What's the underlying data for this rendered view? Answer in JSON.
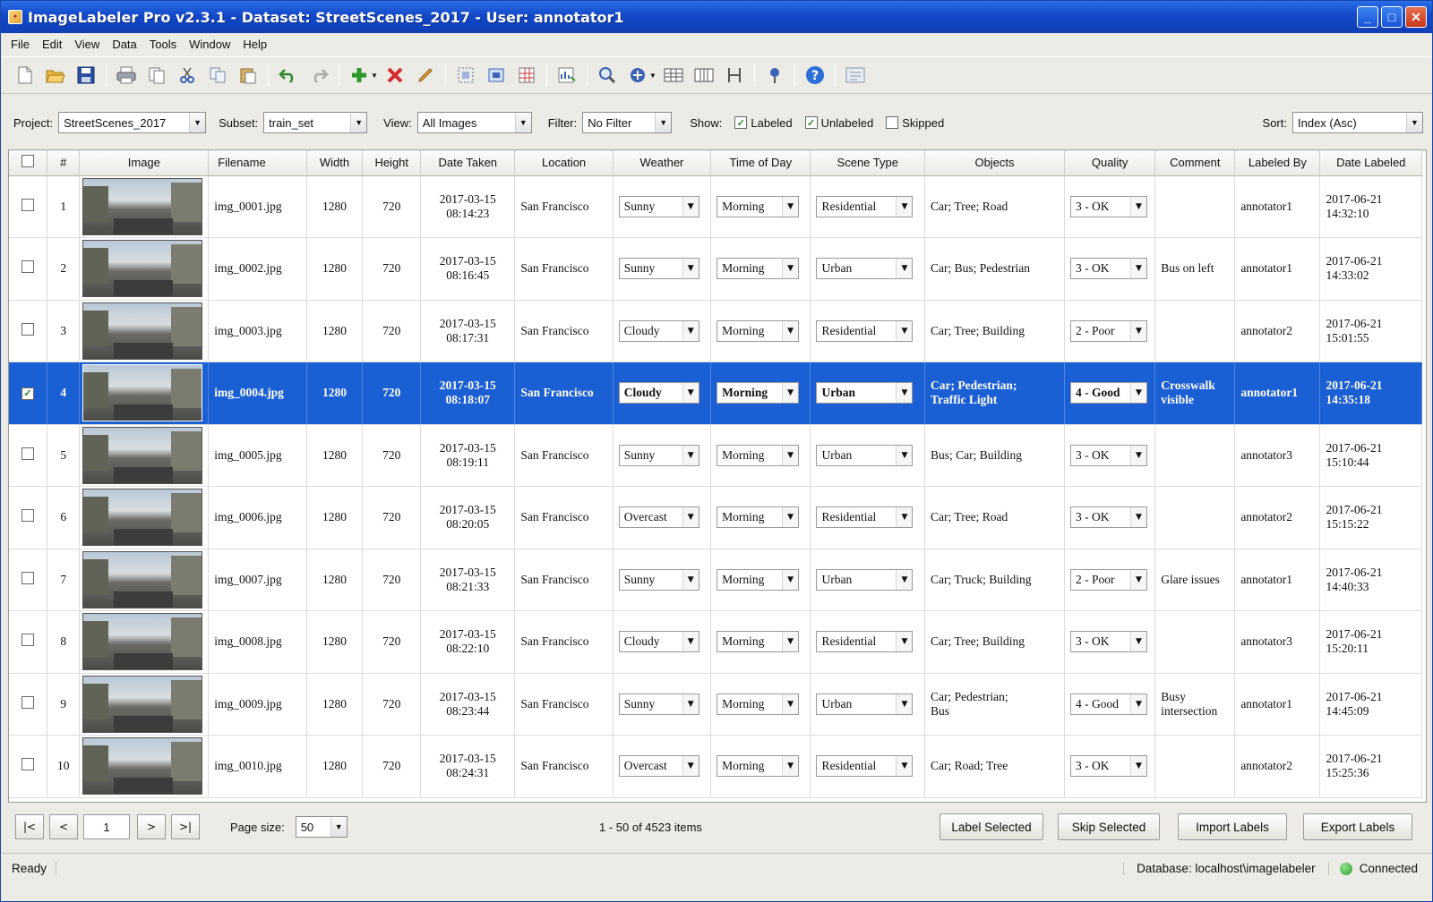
{
  "window": {
    "title": "ImageLabeler Pro v2.3.1 - Dataset: StreetScenes_2017 - User: annotator1",
    "minimize": "_",
    "maximize": "□",
    "close": "✕"
  },
  "menu": [
    "File",
    "Edit",
    "View",
    "Data",
    "Tools",
    "Window",
    "Help"
  ],
  "toolbar_icons": [
    "new-icon",
    "open-icon",
    "save-icon",
    "print-icon",
    "copy-page-icon",
    "cut-icon",
    "copy-icon",
    "paste-icon",
    "undo-icon",
    "redo-icon",
    "add-icon",
    "delete-icon",
    "edit-icon",
    "region-icon",
    "bbox-icon",
    "grid-icon",
    "export-chart-icon",
    "zoom-icon",
    "fit-icon",
    "table-icon",
    "columns-icon",
    "align-icon",
    "pin-icon",
    "help-icon",
    "settings-icon"
  ],
  "filters": {
    "project_label": "Project:",
    "project_value": "StreetScenes_2017",
    "subset_label": "Subset:",
    "subset_value": "train_set",
    "view_label": "View:",
    "view_value": "All Images",
    "filter_label": "Filter:",
    "filter_value": "No Filter",
    "show_label": "Show:",
    "labeled": "Labeled",
    "labeled_checked": true,
    "unlabeled": "Unlabeled",
    "unlabeled_checked": true,
    "skipped": "Skipped",
    "skipped_checked": false,
    "sort_label": "Sort:",
    "sort_value": "Index (Asc)"
  },
  "columns": [
    "#",
    "Image",
    "Filename",
    "Width",
    "Height",
    "Date Taken",
    "Location",
    "Weather",
    "Time of Day",
    "Scene Type",
    "Objects",
    "Quality",
    "Comment",
    "Labeled By",
    "Date Labeled"
  ],
  "rows": [
    {
      "n": "1",
      "file": "img_0001.jpg",
      "w": "1280",
      "h": "720",
      "date1": "2017-03-15",
      "date2": "08:14:23",
      "loc": "San Francisco",
      "weather": "Sunny",
      "tod": "Morning",
      "scene": "Residential",
      "obj1": "Car; Tree; Road",
      "obj2": "",
      "quality": "3 - OK",
      "com1": "",
      "com2": "",
      "by": "annotator1",
      "dl1": "2017-06-21",
      "dl2": "14:32:10",
      "checked": false,
      "selected": false
    },
    {
      "n": "2",
      "file": "img_0002.jpg",
      "w": "1280",
      "h": "720",
      "date1": "2017-03-15",
      "date2": "08:16:45",
      "loc": "San Francisco",
      "weather": "Sunny",
      "tod": "Morning",
      "scene": "Urban",
      "obj1": "Car; Bus; Pedestrian",
      "obj2": "",
      "quality": "3 - OK",
      "com1": "Bus on left",
      "com2": "",
      "by": "annotator1",
      "dl1": "2017-06-21",
      "dl2": "14:33:02",
      "checked": false,
      "selected": false
    },
    {
      "n": "3",
      "file": "img_0003.jpg",
      "w": "1280",
      "h": "720",
      "date1": "2017-03-15",
      "date2": "08:17:31",
      "loc": "San Francisco",
      "weather": "Cloudy",
      "tod": "Morning",
      "scene": "Residential",
      "obj1": "Car; Tree; Building",
      "obj2": "",
      "quality": "2 - Poor",
      "com1": "",
      "com2": "",
      "by": "annotator2",
      "dl1": "2017-06-21",
      "dl2": "15:01:55",
      "checked": false,
      "selected": false
    },
    {
      "n": "4",
      "file": "img_0004.jpg",
      "w": "1280",
      "h": "720",
      "date1": "2017-03-15",
      "date2": "08:18:07",
      "loc": "San Francisco",
      "weather": "Cloudy",
      "tod": "Morning",
      "scene": "Urban",
      "obj1": "Car; Pedestrian;",
      "obj2": "Traffic Light",
      "quality": "4 - Good",
      "com1": "Crosswalk",
      "com2": "visible",
      "by": "annotator1",
      "dl1": "2017-06-21",
      "dl2": "14:35:18",
      "checked": true,
      "selected": true
    },
    {
      "n": "5",
      "file": "img_0005.jpg",
      "w": "1280",
      "h": "720",
      "date1": "2017-03-15",
      "date2": "08:19:11",
      "loc": "San Francisco",
      "weather": "Sunny",
      "tod": "Morning",
      "scene": "Urban",
      "obj1": "Bus; Car; Building",
      "obj2": "",
      "quality": "3 - OK",
      "com1": "",
      "com2": "",
      "by": "annotator3",
      "dl1": "2017-06-21",
      "dl2": "15:10:44",
      "checked": false,
      "selected": false
    },
    {
      "n": "6",
      "file": "img_0006.jpg",
      "w": "1280",
      "h": "720",
      "date1": "2017-03-15",
      "date2": "08:20:05",
      "loc": "San Francisco",
      "weather": "Overcast",
      "tod": "Morning",
      "scene": "Residential",
      "obj1": "Car; Tree; Road",
      "obj2": "",
      "quality": "3 - OK",
      "com1": "",
      "com2": "",
      "by": "annotator2",
      "dl1": "2017-06-21",
      "dl2": "15:15:22",
      "checked": false,
      "selected": false
    },
    {
      "n": "7",
      "file": "img_0007.jpg",
      "w": "1280",
      "h": "720",
      "date1": "2017-03-15",
      "date2": "08:21:33",
      "loc": "San Francisco",
      "weather": "Sunny",
      "tod": "Morning",
      "scene": "Urban",
      "obj1": "Car; Truck; Building",
      "obj2": "",
      "quality": "2 - Poor",
      "com1": "Glare issues",
      "com2": "",
      "by": "annotator1",
      "dl1": "2017-06-21",
      "dl2": "14:40:33",
      "checked": false,
      "selected": false
    },
    {
      "n": "8",
      "file": "img_0008.jpg",
      "w": "1280",
      "h": "720",
      "date1": "2017-03-15",
      "date2": "08:22:10",
      "loc": "San Francisco",
      "weather": "Cloudy",
      "tod": "Morning",
      "scene": "Residential",
      "obj1": "Car; Tree; Building",
      "obj2": "",
      "quality": "3 - OK",
      "com1": "",
      "com2": "",
      "by": "annotator3",
      "dl1": "2017-06-21",
      "dl2": "15:20:11",
      "checked": false,
      "selected": false
    },
    {
      "n": "9",
      "file": "img_0009.jpg",
      "w": "1280",
      "h": "720",
      "date1": "2017-03-15",
      "date2": "08:23:44",
      "loc": "San Francisco",
      "weather": "Sunny",
      "tod": "Morning",
      "scene": "Urban",
      "obj1": "Car; Pedestrian;",
      "obj2": "Bus",
      "quality": "4 - Good",
      "com1": "Busy",
      "com2": "intersection",
      "by": "annotator1",
      "dl1": "2017-06-21",
      "dl2": "14:45:09",
      "checked": false,
      "selected": false
    },
    {
      "n": "10",
      "file": "img_0010.jpg",
      "w": "1280",
      "h": "720",
      "date1": "2017-03-15",
      "date2": "08:24:31",
      "loc": "San Francisco",
      "weather": "Overcast",
      "tod": "Morning",
      "scene": "Residential",
      "obj1": "Car; Road; Tree",
      "obj2": "",
      "quality": "3 - OK",
      "com1": "",
      "com2": "",
      "by": "annotator2",
      "dl1": "2017-06-21",
      "dl2": "15:25:36",
      "checked": false,
      "selected": false
    }
  ],
  "pager": {
    "first": "|<",
    "prev": "<",
    "page": "1",
    "next": ">",
    "last": ">|",
    "page_size_label": "Page size:",
    "page_size": "50",
    "items_info": "1 - 50 of 4523 items",
    "label_selected": "Label Selected",
    "skip_selected": "Skip Selected",
    "import_labels": "Import Labels",
    "export_labels": "Export Labels"
  },
  "status": {
    "ready": "Ready",
    "database": "Database: localhost\\imagelabeler",
    "connection": "Connected"
  },
  "colors": {
    "titlebar": "#1248c9",
    "selection": "#1a5fd4",
    "connected": "#2a9a2a"
  }
}
